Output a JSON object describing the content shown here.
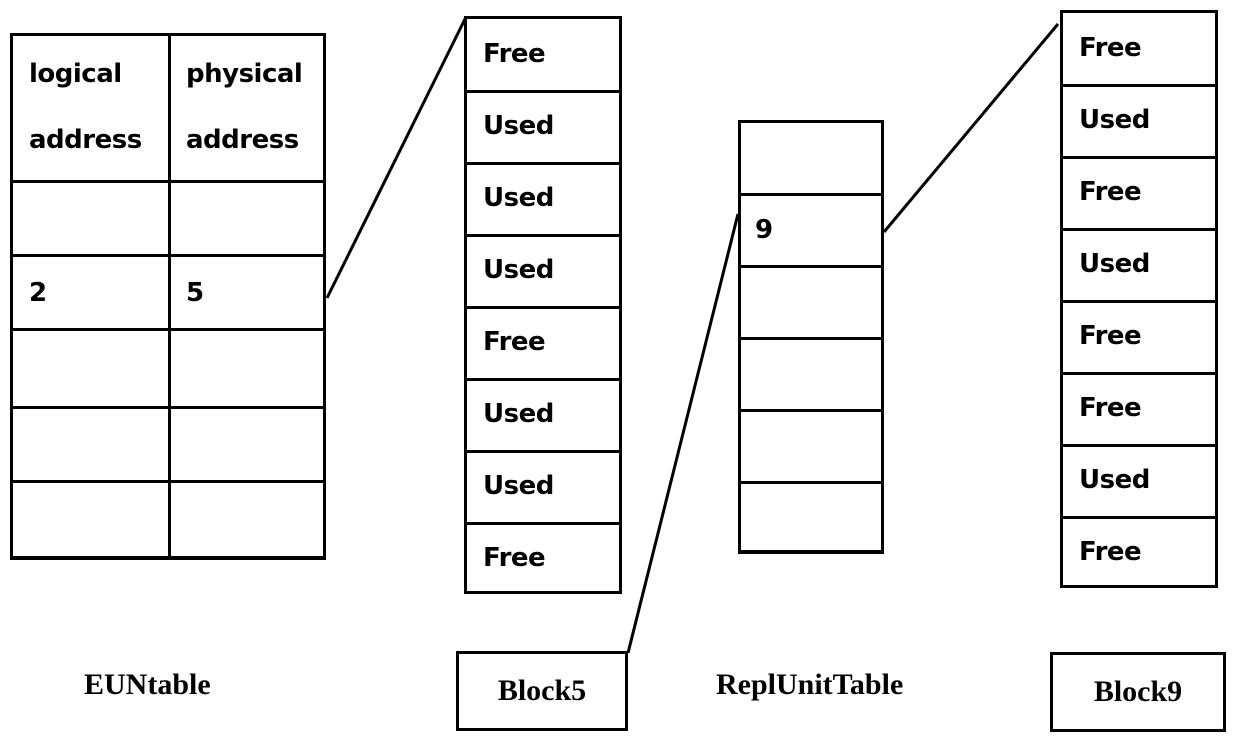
{
  "eun_table": {
    "caption": "EUNtable",
    "headers": [
      {
        "line1": "logical",
        "line2": "address"
      },
      {
        "line1": "physical",
        "line2": "address"
      }
    ],
    "rows": [
      [
        "",
        ""
      ],
      [
        "2",
        "5"
      ],
      [
        "",
        ""
      ],
      [
        "",
        ""
      ],
      [
        "",
        ""
      ]
    ]
  },
  "block5": {
    "label": "Block5",
    "pages": [
      "Free",
      "Used",
      "Used",
      "Used",
      "Free",
      "Used",
      "Used",
      "Free"
    ]
  },
  "repl_unit_table": {
    "caption": "ReplUnitTable",
    "rows": [
      "",
      "9",
      "",
      "",
      "",
      ""
    ]
  },
  "block9": {
    "label": "Block9",
    "pages": [
      "Free",
      "Used",
      "Free",
      "Used",
      "Free",
      "Free",
      "Used",
      "Free"
    ]
  }
}
